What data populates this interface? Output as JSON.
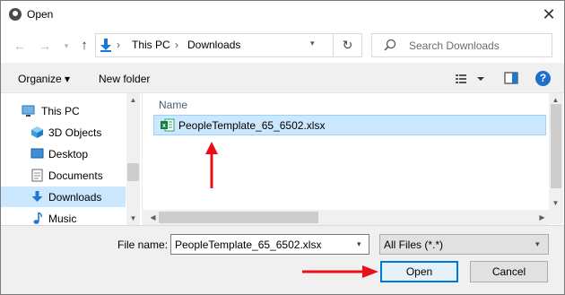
{
  "window": {
    "title": "Open",
    "close_glyph": "✕"
  },
  "address": {
    "back_glyph": "←",
    "forward_glyph": "→",
    "recent_glyph": "▾",
    "up_glyph": "↑",
    "breadcrumb_sep": "›",
    "breadcrumb": [
      "This PC",
      "Downloads"
    ],
    "dropdown_glyph": "▾",
    "refresh_glyph": "↻",
    "search_placeholder": "Search Downloads"
  },
  "toolbar": {
    "organize_label": "Organize ▾",
    "new_folder_label": "New folder",
    "help_glyph": "?"
  },
  "nav": {
    "items": [
      {
        "label": "This PC",
        "icon": "computer-icon"
      },
      {
        "label": "3D Objects",
        "icon": "cube-icon"
      },
      {
        "label": "Desktop",
        "icon": "desktop-icon"
      },
      {
        "label": "Documents",
        "icon": "document-icon"
      },
      {
        "label": "Downloads",
        "icon": "download-icon",
        "selected": true
      },
      {
        "label": "Music",
        "icon": "music-icon"
      }
    ],
    "scroll_up_glyph": "▲",
    "scroll_down_glyph": "▼"
  },
  "files": {
    "column_name": "Name",
    "items": [
      {
        "name": "PeopleTemplate_65_6502.xlsx",
        "icon": "excel-icon",
        "selected": true
      }
    ],
    "scroll_left_glyph": "◀",
    "scroll_right_glyph": "▶"
  },
  "footer": {
    "file_name_label": "File name:",
    "file_name_value": "PeopleTemplate_65_6502.xlsx",
    "filter_value": "All Files (*.*)",
    "open_label": "Open",
    "cancel_label": "Cancel"
  },
  "colors": {
    "accent": "#0078d7",
    "selection": "#cce8ff",
    "annotation_arrow": "#e8111a"
  }
}
